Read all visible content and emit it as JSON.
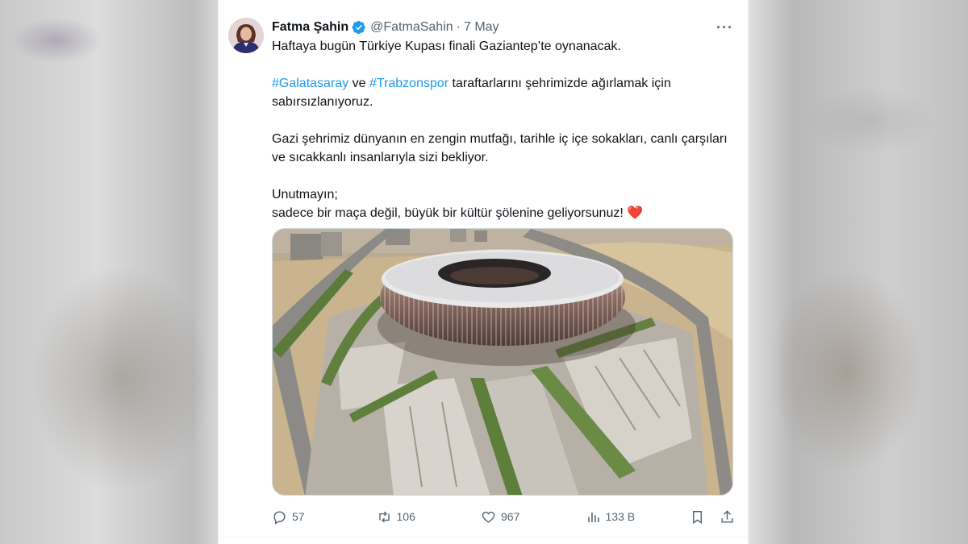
{
  "tweet": {
    "author_name": "Fatma Şahin",
    "author_handle": "@FatmaSahin",
    "separator": "·",
    "date": "7 May",
    "more": "···",
    "text": {
      "line1": "Haftaya bugün Türkiye Kupası finali Gaziantep’te oynanacak.",
      "p2_hashtag1": "#Galatasaray",
      "p2_and": " ve ",
      "p2_hashtag2": "#Trabzonspor",
      "p2_rest": " taraftarlarını şehrimizde ağırlamak için sabırsızlanıyoruz.",
      "p3": "Gazi şehrimiz dünyanın en zengin mutfağı, tarihle iç içe sokakları, canlı çarşıları ve sıcakkanlı insanlarıyla sizi bekliyor.",
      "p4_line1": "Unutmayın;",
      "p4_line2": "sadece bir maça değil, büyük bir kültür şölenine geliyorsunuz! ",
      "heart": "❤️"
    }
  },
  "stats": {
    "replies": "57",
    "reposts": "106",
    "likes": "967",
    "views": "133 B"
  },
  "colors": {
    "accent": "#1d9bf0",
    "text": "#0f1419",
    "muted": "#536471",
    "heart": "#e0245e"
  },
  "icons": [
    "verified-badge-icon",
    "more-icon",
    "reply-icon",
    "repost-icon",
    "like-icon",
    "views-icon",
    "bookmark-icon",
    "share-icon"
  ]
}
